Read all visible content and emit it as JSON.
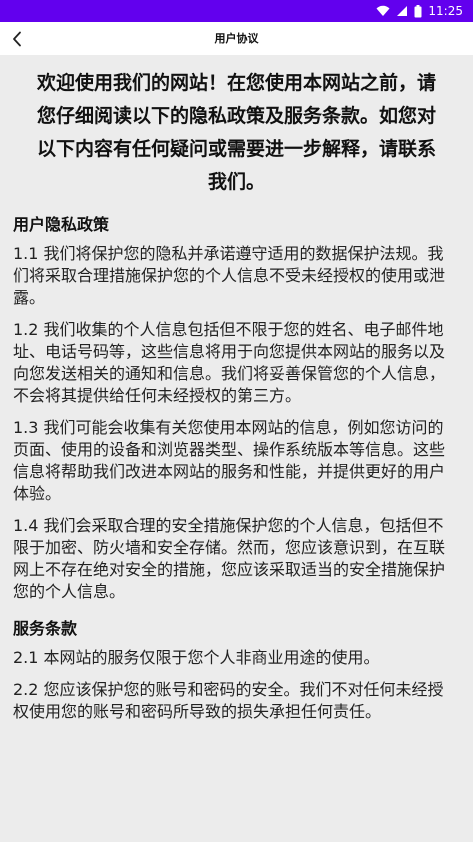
{
  "status_bar": {
    "time": "11:25",
    "icons": [
      "wifi-icon",
      "signal-icon",
      "battery-icon"
    ],
    "background": "#6200ee"
  },
  "header": {
    "title": "用户协议",
    "back_icon": "chevron-left-icon"
  },
  "content": {
    "intro": "欢迎使用我们的网站！在您使用本网站之前，请您仔细阅读以下的隐私政策及服务条款。如您对以下内容有任何疑问或需要进一步解释，请联系我们。",
    "privacy_title": "用户隐私政策",
    "privacy_paragraphs": [
      "1.1 我们将保护您的隐私并承诺遵守适用的数据保护法规。我们将采取合理措施保护您的个人信息不受未经授权的使用或泄露。",
      "1.2 我们收集的个人信息包括但不限于您的姓名、电子邮件地址、电话号码等，这些信息将用于向您提供本网站的服务以及向您发送相关的通知和信息。我们将妥善保管您的个人信息，不会将其提供给任何未经授权的第三方。",
      "1.3 我们可能会收集有关您使用本网站的信息，例如您访问的页面、使用的设备和浏览器类型、操作系统版本等信息。这些信息将帮助我们改进本网站的服务和性能，并提供更好的用户体验。",
      "1.4 我们会采取合理的安全措施保护您的个人信息，包括但不限于加密、防火墙和安全存储。然而，您应该意识到，在互联网上不存在绝对安全的措施，您应该采取适当的安全措施保护您的个人信息。"
    ],
    "terms_title": "服务条款",
    "terms_paragraphs": [
      "2.1 本网站的服务仅限于您个人非商业用途的使用。",
      "2.2 您应该保护您的账号和密码的安全。我们不对任何未经授权使用您的账号和密码所导致的损失承担任何责任。"
    ]
  }
}
